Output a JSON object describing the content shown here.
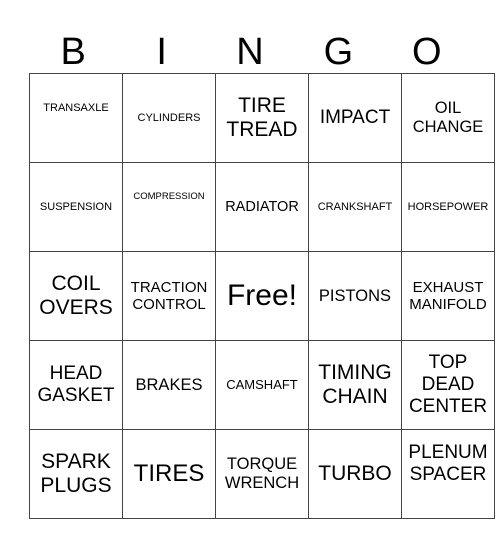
{
  "header": [
    "B",
    "I",
    "N",
    "G",
    "O"
  ],
  "rows": [
    [
      "TRANSAXLE",
      "CYLINDERS",
      "TIRE TREAD",
      "IMPACT",
      "OIL CHANGE"
    ],
    [
      "SUSPENSION",
      "COMPRESSION",
      "RADIATOR",
      "CRANKSHAFT",
      "HORSEPOWER"
    ],
    [
      "COIL OVERS",
      "TRACTION CONTROL",
      "Free!",
      "PISTONS",
      "EXHAUST MANIFOLD"
    ],
    [
      "HEAD GASKET",
      "BRAKES",
      "CAMSHAFT",
      "TIMING CHAIN",
      "TOP DEAD CENTER"
    ],
    [
      "SPARK PLUGS",
      "TIRES",
      "TORQUE WRENCH",
      "TURBO",
      "PLENUM SPACER"
    ]
  ]
}
